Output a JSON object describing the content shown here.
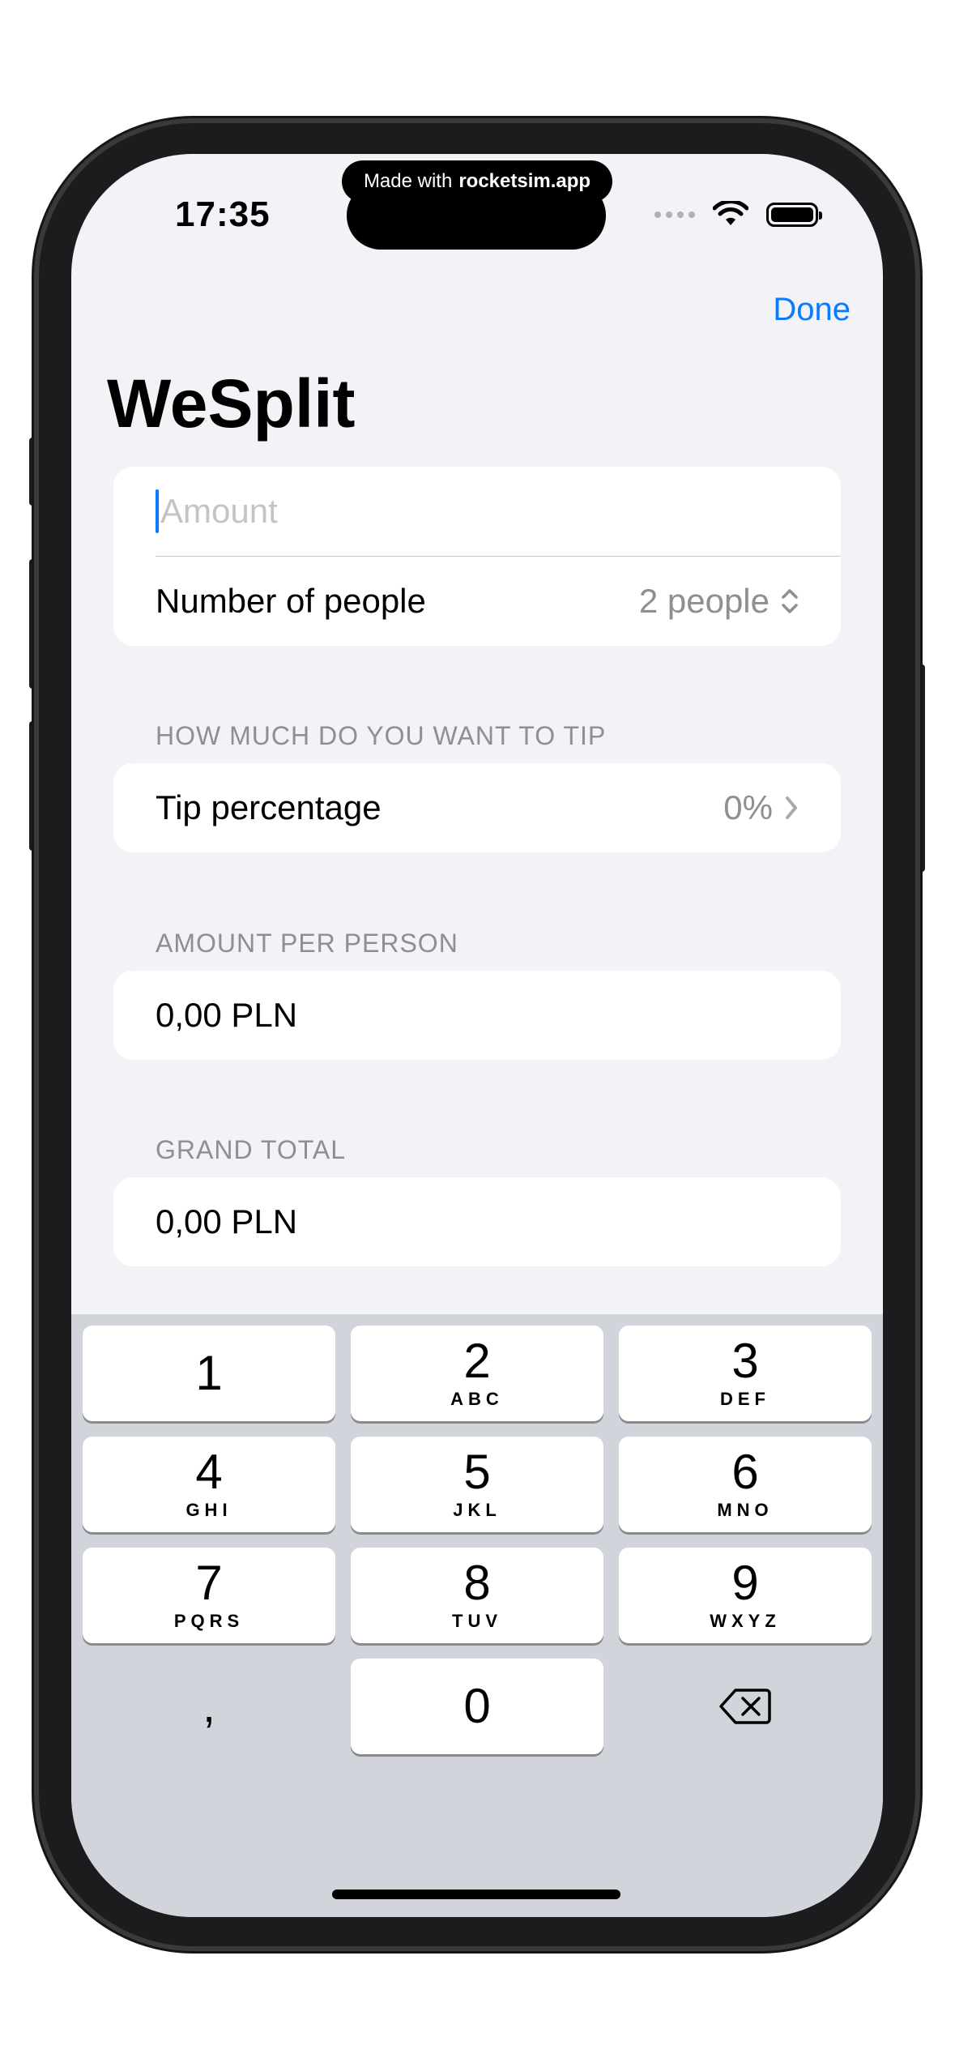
{
  "status_bar": {
    "time": "17:35",
    "made_with_prefix": "Made with",
    "made_with_brand": "rocketsim.app"
  },
  "nav": {
    "done_label": "Done",
    "title": "WeSplit"
  },
  "form": {
    "amount_placeholder": "Amount",
    "people_label": "Number of people",
    "people_value": "2 people",
    "tip_section": "HOW MUCH DO YOU WANT TO TIP",
    "tip_label": "Tip percentage",
    "tip_value": "0%",
    "per_person_section": "AMOUNT PER PERSON",
    "per_person_value": "0,00 PLN",
    "grand_total_section": "GRAND TOTAL",
    "grand_total_value": "0,00 PLN"
  },
  "keypad": {
    "keys": [
      {
        "num": "1",
        "letters": ""
      },
      {
        "num": "2",
        "letters": "ABC"
      },
      {
        "num": "3",
        "letters": "DEF"
      },
      {
        "num": "4",
        "letters": "GHI"
      },
      {
        "num": "5",
        "letters": "JKL"
      },
      {
        "num": "6",
        "letters": "MNO"
      },
      {
        "num": "7",
        "letters": "PQRS"
      },
      {
        "num": "8",
        "letters": "TUV"
      },
      {
        "num": "9",
        "letters": "WXYZ"
      },
      {
        "num": "0",
        "letters": ""
      }
    ],
    "decimal": ","
  },
  "colors": {
    "accent": "#0a7aff",
    "background": "#f2f2f7",
    "keyboard": "#d1d4db"
  }
}
